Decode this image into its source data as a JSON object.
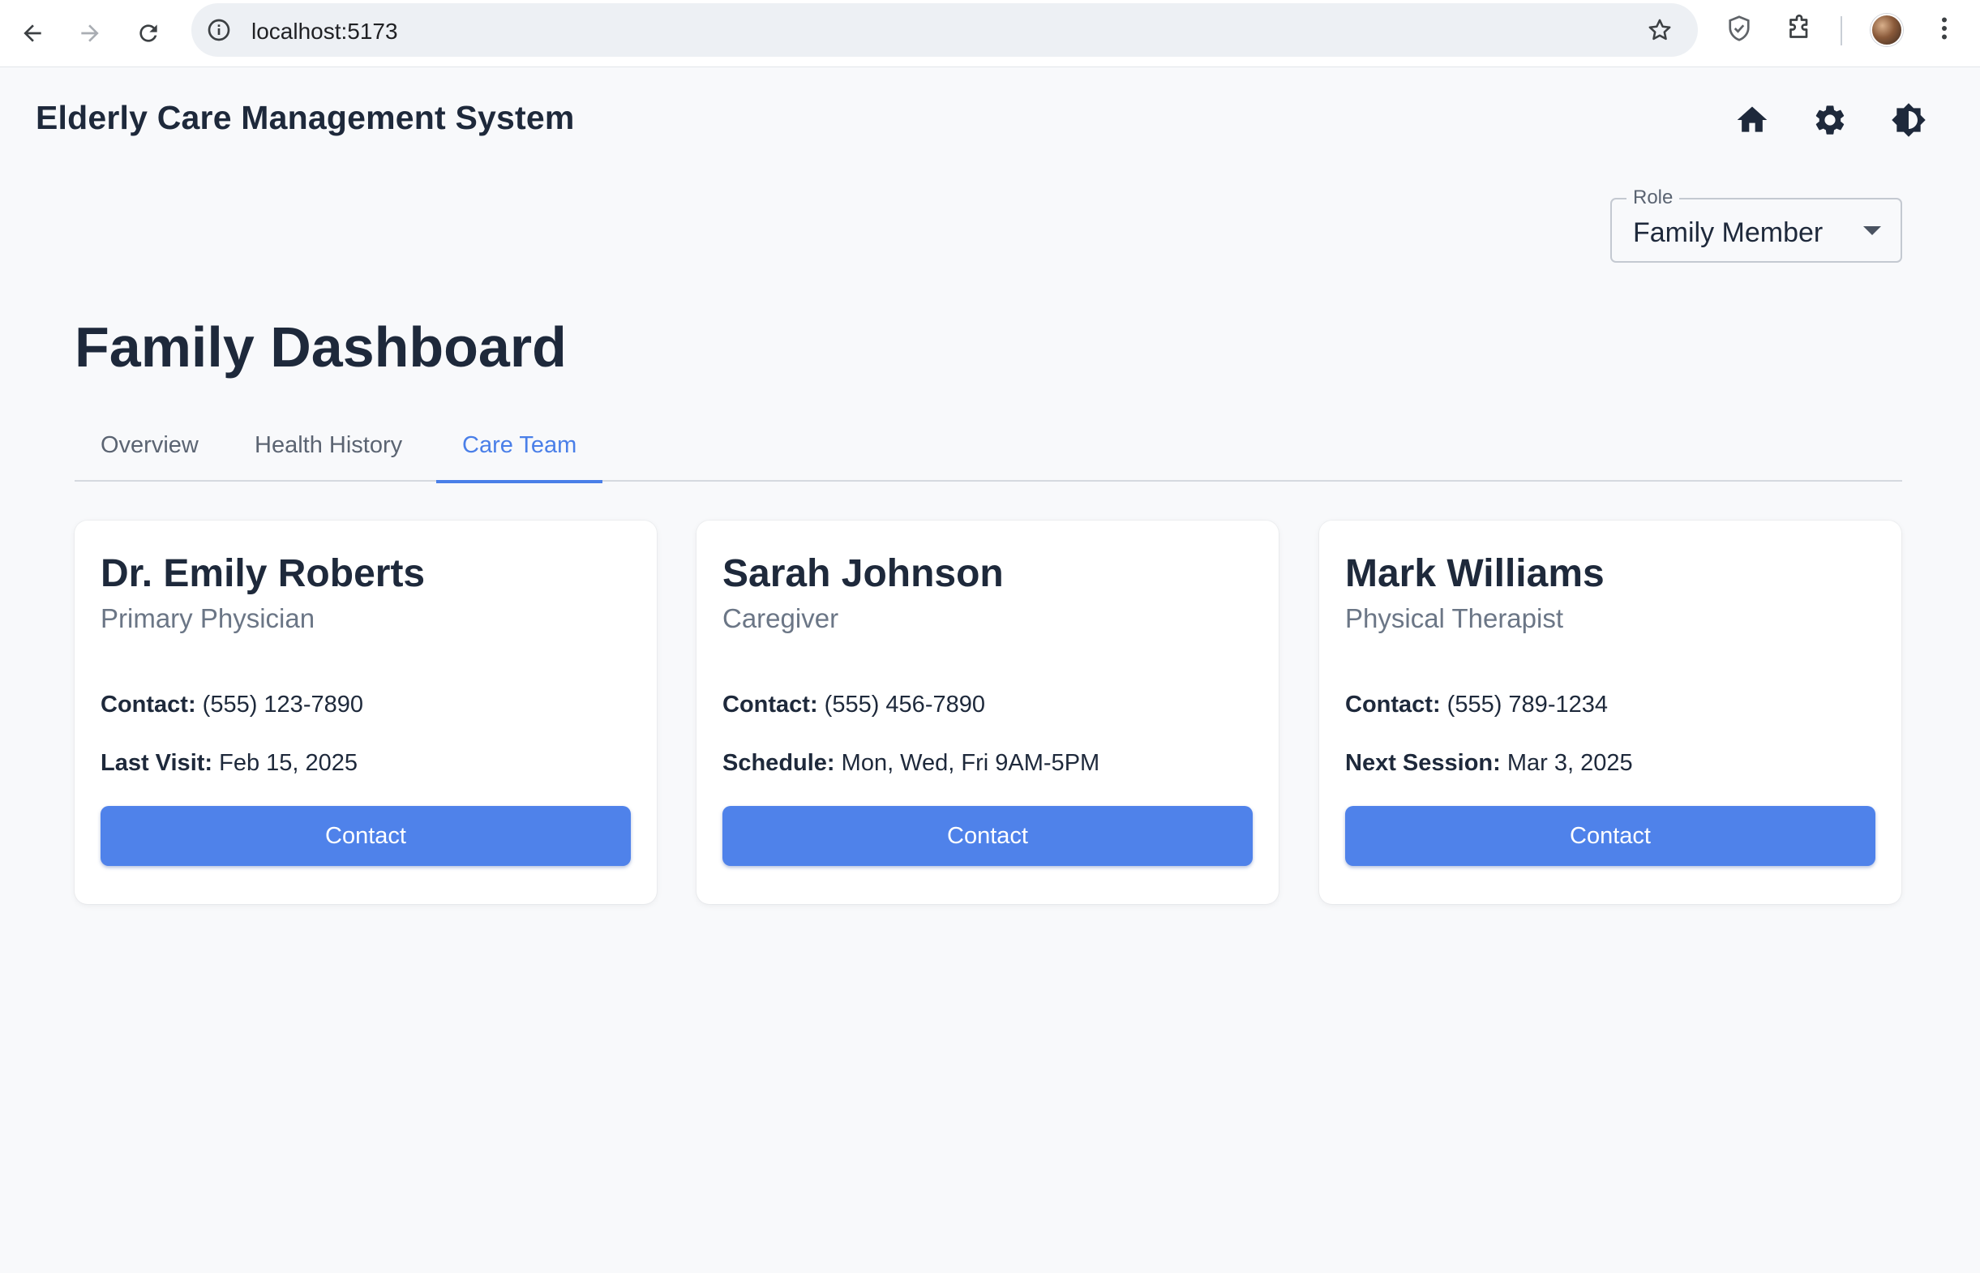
{
  "browser": {
    "url": "localhost:5173",
    "icons": [
      "back-arrow-icon",
      "forward-arrow-icon",
      "reload-icon",
      "site-info-icon",
      "bookmark-star-icon",
      "shield-extension-icon",
      "puzzle-extension-icon",
      "profile-avatar",
      "more-menu-icon"
    ]
  },
  "app": {
    "title": "Elderly Care Management System",
    "header_icons": [
      "home-icon",
      "settings-gear-icon",
      "theme-toggle-icon"
    ]
  },
  "role_select": {
    "label": "Role",
    "value": "Family Member"
  },
  "dashboard": {
    "title": "Family Dashboard",
    "tabs": [
      {
        "label": "Overview",
        "active": false
      },
      {
        "label": "Health History",
        "active": false
      },
      {
        "label": "Care Team",
        "active": true
      }
    ]
  },
  "care_team": [
    {
      "name": "Dr. Emily Roberts",
      "role": "Primary Physician",
      "field1_label": "Contact:",
      "field1_value": "(555) 123-7890",
      "field2_label": "Last Visit:",
      "field2_value": "Feb 15, 2025",
      "button_label": "Contact"
    },
    {
      "name": "Sarah Johnson",
      "role": "Caregiver",
      "field1_label": "Contact:",
      "field1_value": "(555) 456-7890",
      "field2_label": "Schedule:",
      "field2_value": "Mon, Wed, Fri 9AM-5PM",
      "button_label": "Contact"
    },
    {
      "name": "Mark Williams",
      "role": "Physical Therapist",
      "field1_label": "Contact:",
      "field1_value": "(555) 789-1234",
      "field2_label": "Next Session:",
      "field2_value": "Mar 3, 2025",
      "button_label": "Contact"
    }
  ],
  "colors": {
    "accent": "#4a7fe8",
    "button": "#4f82ea",
    "background": "#f8f9fb",
    "text": "#1e293b",
    "muted": "#6b7686"
  }
}
